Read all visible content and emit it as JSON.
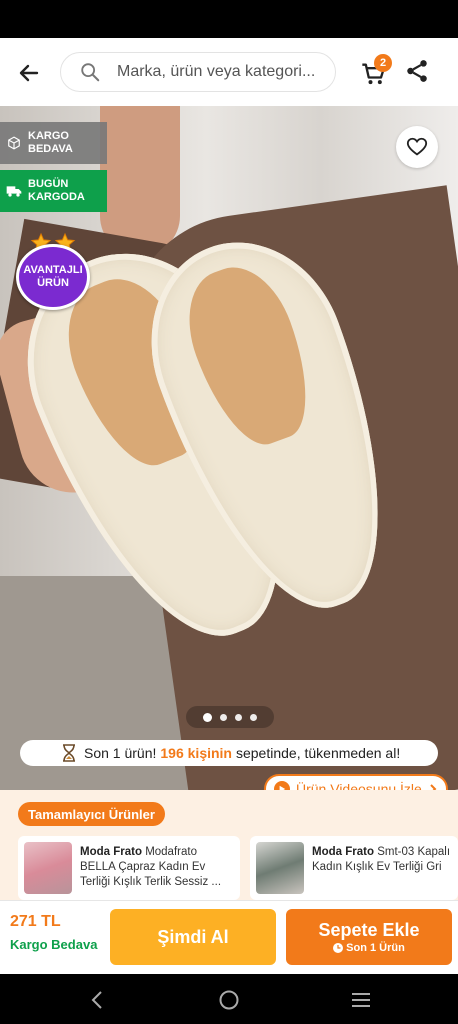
{
  "search": {
    "placeholder": "Marka, ürün veya kategori..."
  },
  "cart": {
    "count": "2"
  },
  "badges": {
    "cargo_free": "KARGO BEDAVA",
    "cargo_free_line1": "KARGO",
    "cargo_free_line2": "BEDAVA",
    "today_cargo_line1": "BUGÜN",
    "today_cargo_line2": "KARGODA",
    "advantage_line1": "AVANTAJLI",
    "advantage_line2": "ÜRÜN"
  },
  "gallery": {
    "dot_count": 4,
    "active_index": 0
  },
  "stock": {
    "prefix": "Son 1 ürün!",
    "count": "196 kişinin",
    "suffix": "sepetinde, tükenmeden al!"
  },
  "video": {
    "label": "Ürün Videosunu İzle"
  },
  "complementary": {
    "title": "Tamamlayıcı Ürünler",
    "items": [
      {
        "brand": "Moda Frato",
        "line1": "Modafrato",
        "line2": "BELLA Çapraz Kadın Ev",
        "line3": "Terliği Kışlık Terlik Sessiz ..."
      },
      {
        "brand": "Moda Frato",
        "line1": "Smt-03 Kapalı",
        "line2": "Kadın Kışlık Ev Terliği Gri",
        "line3": ""
      }
    ]
  },
  "purchase": {
    "price": "271 TL",
    "shipping": "Kargo Bedava",
    "buy_now": "Şimdi Al",
    "add_to_cart": "Sepete Ekle",
    "add_to_cart_sub": "Son 1 Ürün"
  },
  "colors": {
    "accent": "#f27a1a",
    "green": "#0ea04b",
    "yellow": "#fdb024",
    "purple": "#7b2ad0"
  }
}
